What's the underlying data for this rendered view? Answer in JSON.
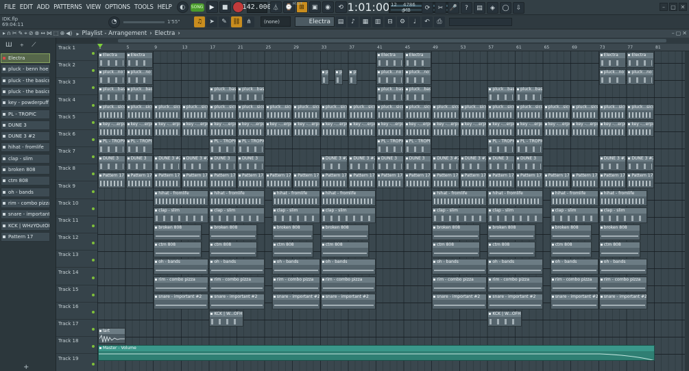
{
  "menu": [
    "FILE",
    "EDIT",
    "ADD",
    "PATTERNS",
    "VIEW",
    "OPTIONS",
    "TOOLS",
    "HELP"
  ],
  "transport": {
    "mode": "SONG",
    "tempo": "142.000",
    "time": "1:01:00",
    "time_unit": "M:S:T",
    "cpu": "12",
    "ram": "4786 MB",
    "poly": "0"
  },
  "project": {
    "file": "IDK.flp",
    "duration": "69:04:11"
  },
  "row2": {
    "snap": "(none)",
    "pattern": "Electra",
    "position": "1'55\""
  },
  "playlist": {
    "title": "Playlist - Arrangement",
    "crumb": "Electra"
  },
  "patterns": [
    "Electra",
    "pluck - benn hoe",
    "pluck - the basics",
    "pluck - the basics #2",
    "key - powderpuff",
    "PL - TROPIC",
    "DUNE 3",
    "DUNE 3 #2",
    "hihat - fromlife",
    "clap - slim",
    "broken 808",
    "ctm 808",
    "oh - bands",
    "rim - combo pizza",
    "snare - important #2",
    "KCK | WHzYOutOFHERE |",
    "Pattern 17"
  ],
  "ruler": [
    "1",
    "5",
    "9",
    "13",
    "17",
    "21",
    "25",
    "29",
    "33",
    "37",
    "41",
    "45",
    "49",
    "53",
    "57",
    "61",
    "65",
    "69",
    "73",
    "77",
    "81"
  ],
  "tracks": [
    "Track 1",
    "Track 2",
    "Track 3",
    "Track 4",
    "Track 5",
    "Track 6",
    "Track 7",
    "Track 8",
    "Track 9",
    "Track 10",
    "Track 11",
    "Track 12",
    "Track 13",
    "Track 14",
    "Track 15",
    "Track 16",
    "Track 17",
    "Track 18",
    "Track 19"
  ],
  "clip_labels": {
    "t1": "Electra",
    "t2": "pluck...no hoe",
    "t3": "pluck...basics",
    "t4": "pluck...sics #2",
    "t5": "key -...erpuff",
    "t6": "PL - TROPIC",
    "t7a": "DUNE 3",
    "t7b": "DUNE 3 #2",
    "t8": "Pattern 17",
    "t9": "hihat - fromlife",
    "t10": "clap - slim",
    "t11": "broken 808",
    "t12": "ctm 808",
    "t13": "oh - bands",
    "t14": "rim - combo pizza",
    "t15": "snare - important #2",
    "t16": "KCK | W...OFHERE",
    "t17": "lart",
    "t18": "Master - Volume"
  }
}
